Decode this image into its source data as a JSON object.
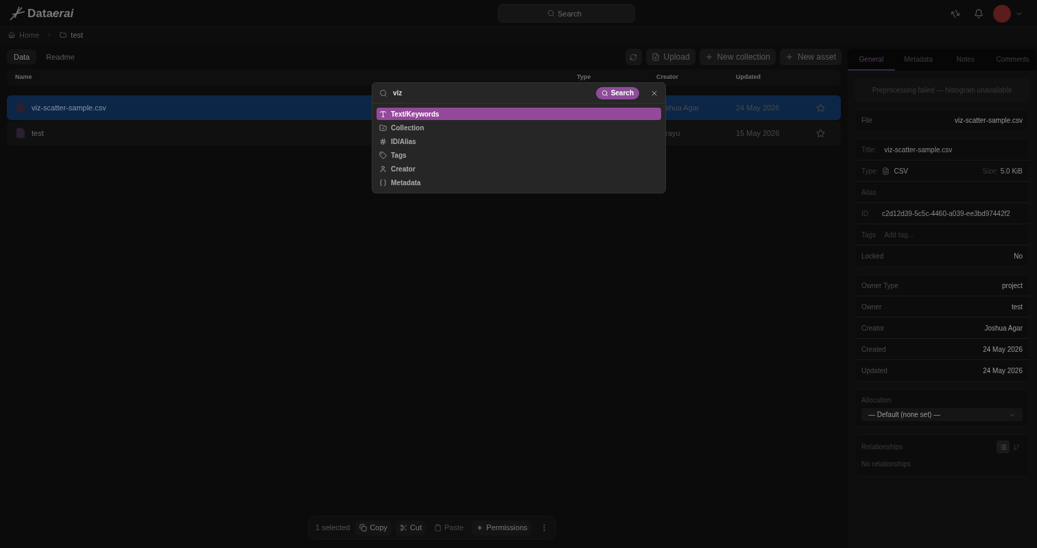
{
  "logo": {
    "name": "Data",
    "accent": "erai"
  },
  "top_search": {
    "placeholder": "Search"
  },
  "breadcrumb": [
    {
      "label": "Home",
      "kind": "home"
    },
    {
      "label": "test",
      "kind": "folder"
    }
  ],
  "view_tabs": [
    {
      "label": "Data",
      "selected": true
    },
    {
      "label": "Readme",
      "selected": false
    }
  ],
  "actions": [
    {
      "label": "Upload",
      "kind": "upload"
    },
    {
      "label": "New collection",
      "kind": "plus"
    },
    {
      "label": "New asset",
      "kind": "plus"
    }
  ],
  "table": {
    "columns": [
      "Name",
      "Type",
      "Creator",
      "Updated"
    ],
    "rows": [
      {
        "name": "viz-scatter-sample.csv",
        "creator": "shua Agar",
        "updated": "24 May 2026",
        "selected": true
      },
      {
        "name": "test",
        "creator": "rayu",
        "updated": "15 May 2026",
        "selected": false
      }
    ]
  },
  "search_dialog": {
    "value": "viz",
    "button": "Search",
    "options": [
      {
        "label": "Text/Keywords",
        "kind": "text",
        "selected": true
      },
      {
        "label": "Collection",
        "kind": "collection",
        "selected": false
      },
      {
        "label": "ID/Alias",
        "kind": "id",
        "selected": false
      },
      {
        "label": "Tags",
        "kind": "tags",
        "selected": false
      },
      {
        "label": "Creator",
        "kind": "creator",
        "selected": false
      },
      {
        "label": "Metadata",
        "kind": "metadata",
        "selected": false
      }
    ]
  },
  "details": {
    "tabs": [
      {
        "label": "General",
        "selected": true
      },
      {
        "label": "Metadata",
        "selected": false
      },
      {
        "label": "Notes",
        "selected": false
      },
      {
        "label": "Comments",
        "selected": false
      }
    ],
    "notice": "Preprocessing failed — histogram unavailable",
    "file": {
      "label": "File",
      "value": "viz-scatter-sample.csv"
    },
    "title": {
      "label": "Title:",
      "value": "viz-scatter-sample.csv"
    },
    "type": {
      "label": "Type:",
      "value": "CSV"
    },
    "size": {
      "label": "Size:",
      "value": "5.0 KiB"
    },
    "alias": {
      "label": "Alias"
    },
    "id": {
      "label": "ID",
      "value": "c2d12d39-5c5c-4460-a039-ee3bd97442f2"
    },
    "tags": {
      "label": "Tags",
      "placeholder": "Add tag..."
    },
    "locked": {
      "label": "Locked",
      "value": "No"
    },
    "owner_rows": [
      {
        "label": "Owner Type",
        "value": "project"
      },
      {
        "label": "Owner",
        "value": "test"
      },
      {
        "label": "Creator",
        "value": "Joshua Agar"
      },
      {
        "label": "Created",
        "value": "24 May 2026"
      },
      {
        "label": "Updated",
        "value": "24 May 2026"
      }
    ],
    "allocation": {
      "label": "Allocation",
      "value": "— Default (none set) —"
    },
    "relationships": {
      "title": "Relationships",
      "empty": "No relationships",
      "views": [
        {
          "kind": "list",
          "selected": true
        },
        {
          "kind": "tree",
          "selected": false
        }
      ]
    }
  },
  "selection_bar": {
    "count": "1 selected",
    "actions": [
      {
        "label": "Copy",
        "kind": "copy",
        "disabled": false
      },
      {
        "label": "Cut",
        "kind": "cut",
        "disabled": false
      },
      {
        "label": "Paste",
        "kind": "paste",
        "disabled": true
      },
      {
        "label": "Permissions",
        "kind": "permissions",
        "disabled": false
      }
    ]
  }
}
